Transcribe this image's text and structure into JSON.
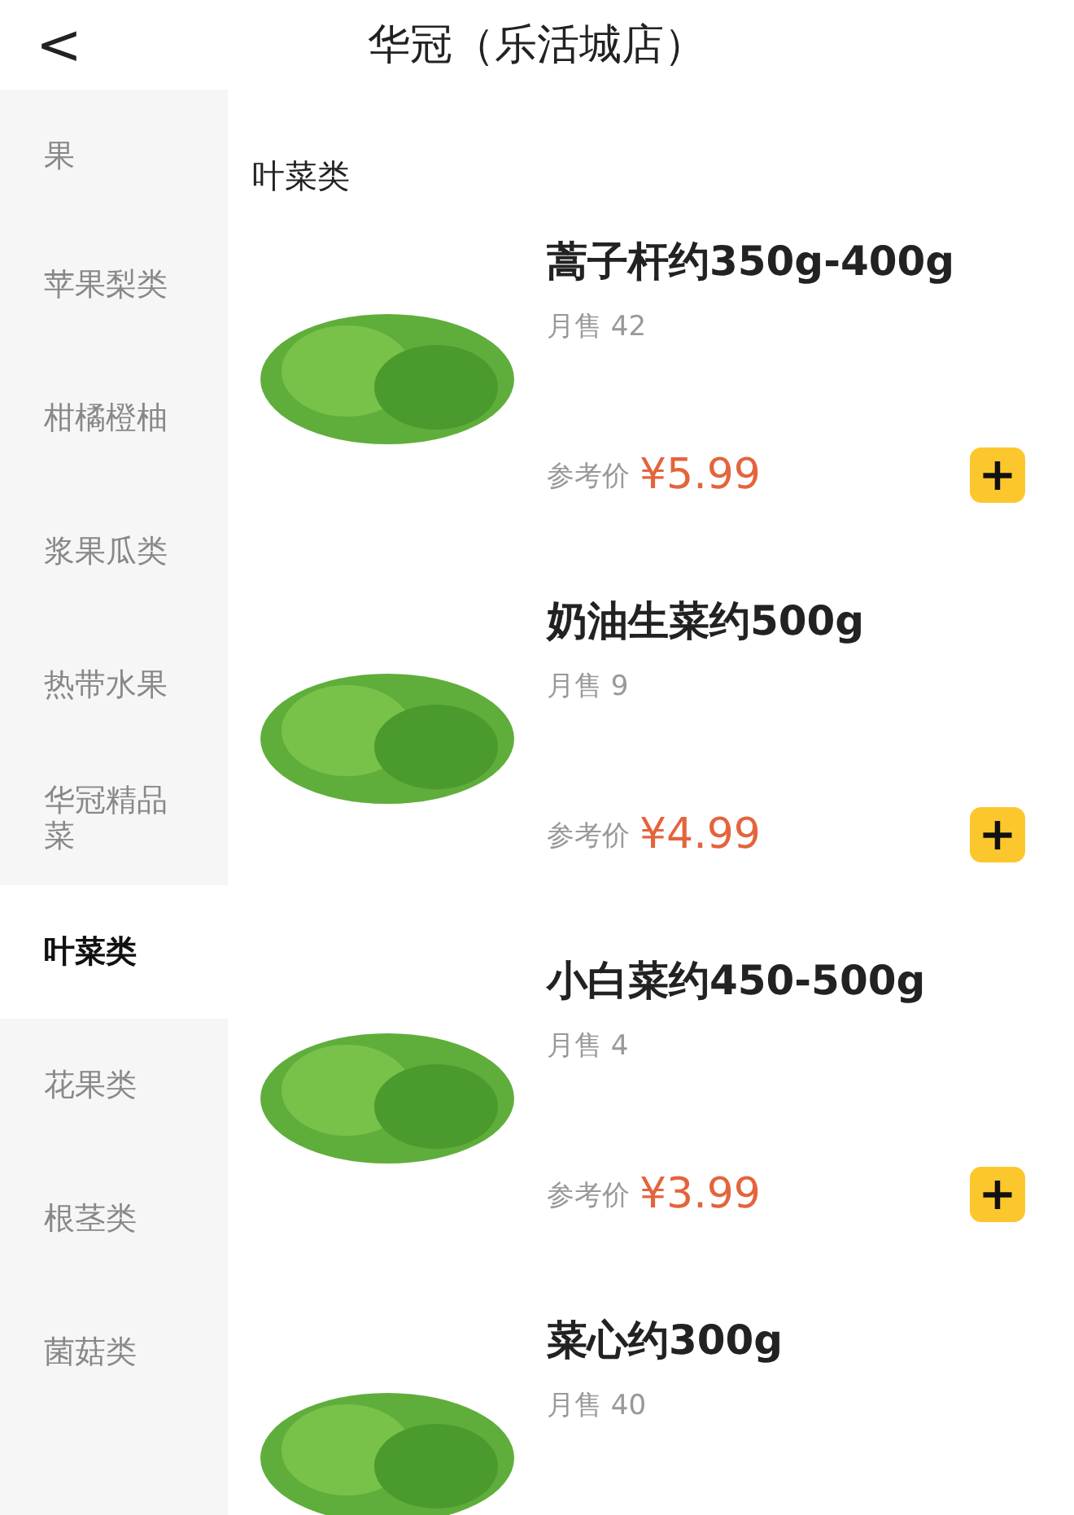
{
  "header": {
    "back": "<",
    "title": "华冠（乐活城店）"
  },
  "categories": [
    {
      "label": "果",
      "selected": false
    },
    {
      "label": "苹果梨类",
      "selected": false
    },
    {
      "label": "柑橘橙柚",
      "selected": false
    },
    {
      "label": "浆果瓜类",
      "selected": false
    },
    {
      "label": "热带水果",
      "selected": false
    },
    {
      "label": "华冠精品菜",
      "selected": false
    },
    {
      "label": "叶菜类",
      "selected": true
    },
    {
      "label": "花果类",
      "selected": false
    },
    {
      "label": "根茎类",
      "selected": false
    },
    {
      "label": "菌菇类",
      "selected": false
    }
  ],
  "section_title": "叶菜类",
  "products": [
    {
      "name": "蒿子杆约350g-400g",
      "sales": "月售 42",
      "price_label": "参考价",
      "price": "¥5.99",
      "add": "+"
    },
    {
      "name": "奶油生菜约500g",
      "sales": "月售 9",
      "price_label": "参考价",
      "price": "¥4.99",
      "add": "+"
    },
    {
      "name": "小白菜约450-500g",
      "sales": "月售 4",
      "price_label": "参考价",
      "price": "¥3.99",
      "add": "+"
    },
    {
      "name": "菜心约300g",
      "sales": "月售 40"
    }
  ]
}
